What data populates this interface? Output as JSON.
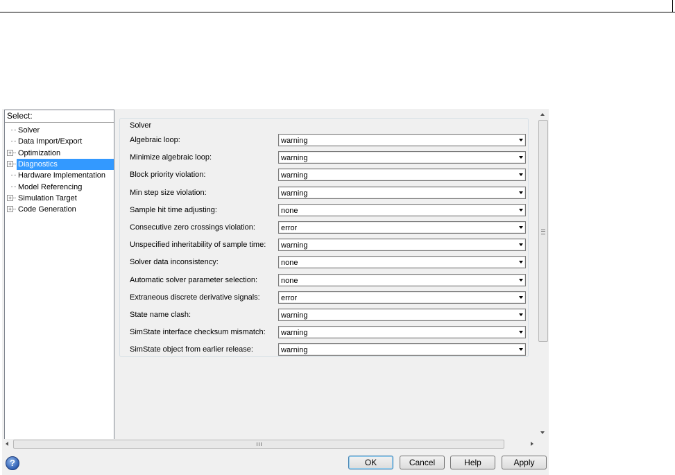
{
  "tree": {
    "header": "Select:",
    "items": [
      {
        "label": "Solver",
        "expandable": false
      },
      {
        "label": "Data Import/Export",
        "expandable": false
      },
      {
        "label": "Optimization",
        "expandable": true
      },
      {
        "label": "Diagnostics",
        "expandable": true,
        "selected": true
      },
      {
        "label": "Hardware Implementation",
        "expandable": false
      },
      {
        "label": "Model Referencing",
        "expandable": false
      },
      {
        "label": "Simulation Target",
        "expandable": true
      },
      {
        "label": "Code Generation",
        "expandable": true
      }
    ]
  },
  "group": {
    "title": "Solver",
    "rows": [
      {
        "label": "Algebraic loop:",
        "value": "warning"
      },
      {
        "label": "Minimize algebraic loop:",
        "value": "warning"
      },
      {
        "label": "Block priority violation:",
        "value": "warning"
      },
      {
        "label": "Min step size violation:",
        "value": "warning"
      },
      {
        "label": "Sample hit time adjusting:",
        "value": "none"
      },
      {
        "label": "Consecutive zero crossings violation:",
        "value": "error"
      },
      {
        "label": "Unspecified inheritability of sample time:",
        "value": "warning"
      },
      {
        "label": "Solver data inconsistency:",
        "value": "none"
      },
      {
        "label": "Automatic solver parameter selection:",
        "value": "none"
      },
      {
        "label": "Extraneous discrete derivative signals:",
        "value": "error"
      },
      {
        "label": "State name clash:",
        "value": "warning"
      },
      {
        "label": "SimState interface checksum mismatch:",
        "value": "warning"
      },
      {
        "label": "SimState object from earlier release:",
        "value": "warning"
      }
    ]
  },
  "buttons": {
    "help_icon": "?",
    "ok": "OK",
    "cancel": "Cancel",
    "help": "Help",
    "apply": "Apply"
  },
  "colors": {
    "selection": "#3399ff",
    "dialog_bg": "#f0f0f0"
  }
}
